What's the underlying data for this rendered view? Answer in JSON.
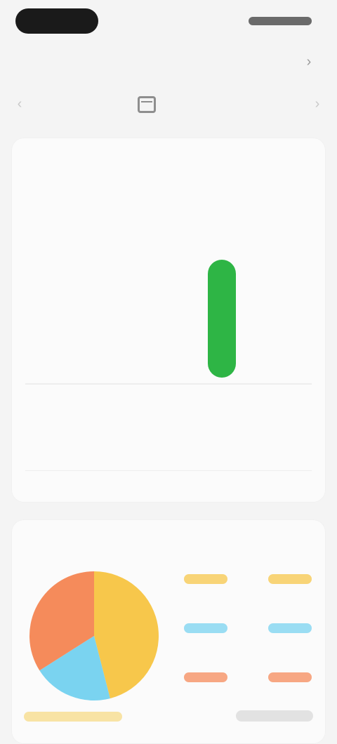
{
  "header": {
    "title": "",
    "action_icon": "chevron-right-icon"
  },
  "date_bar": {
    "date_label": "",
    "prev_icon": "chevron-left-icon",
    "next_icon": "chevron-right-icon"
  },
  "weekly_card": {
    "title": "",
    "left_label": "",
    "left_value": "",
    "right_label": "",
    "right_value": "",
    "bar_label": "",
    "bar_sub": "",
    "summary_text": "",
    "summary_num_1": "",
    "summary_num_2": ""
  },
  "distribution_card": {
    "title": ""
  },
  "colors": {
    "green": "#2eb545",
    "green_text": "#2fbf5a",
    "pie_orange": "#f58b5b",
    "pie_yellow": "#f7c74b",
    "pie_blue": "#7ad3f0"
  },
  "chart_data": {
    "type": "pie",
    "slices": [
      {
        "value": 0.46,
        "color": "#f7c74b"
      },
      {
        "value": 0.2,
        "color": "#7ad3f0"
      },
      {
        "value": 0.34,
        "color": "#f58b5b"
      }
    ]
  }
}
